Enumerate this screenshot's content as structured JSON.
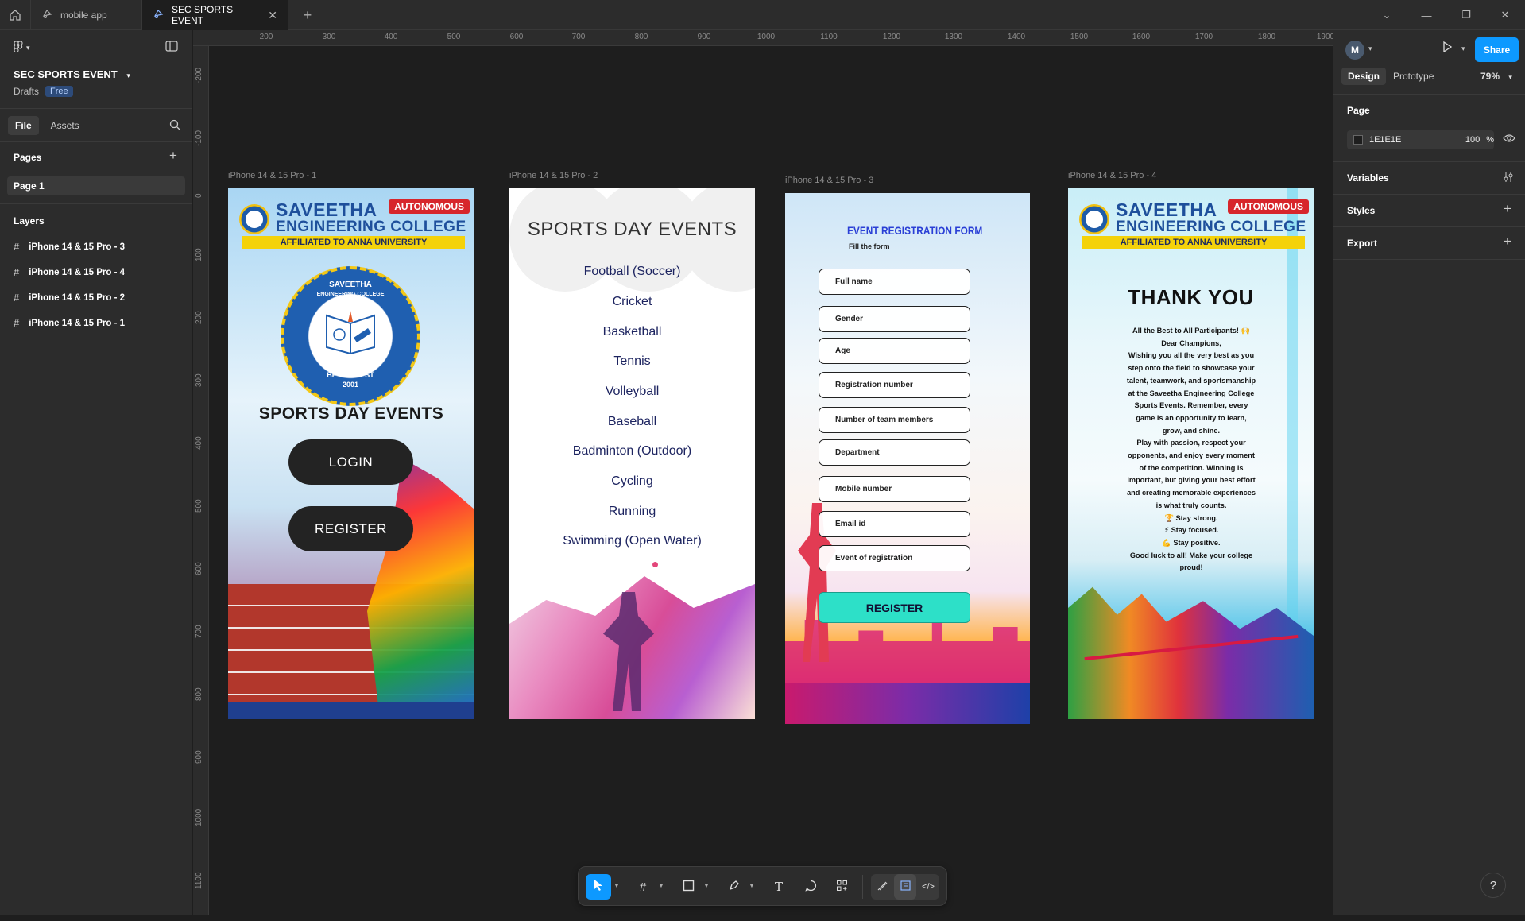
{
  "titlebar": {
    "tabs": [
      {
        "label": "mobile app"
      },
      {
        "label": "SEC SPORTS EVENT"
      }
    ]
  },
  "project": {
    "title": "SEC SPORTS EVENT",
    "location": "Drafts",
    "plan_badge": "Free"
  },
  "left_panel": {
    "tabs": [
      "File",
      "Assets"
    ],
    "pages_heading": "Pages",
    "pages": [
      "Page 1"
    ],
    "layers_heading": "Layers",
    "layers": [
      "iPhone 14 & 15 Pro - 3",
      "iPhone 14 & 15 Pro - 4",
      "iPhone 14 & 15 Pro - 2",
      "iPhone 14 & 15 Pro - 1"
    ]
  },
  "rulers": {
    "top": [
      "200",
      "300",
      "400",
      "500",
      "600",
      "700",
      "800",
      "900",
      "1000",
      "1100",
      "1200",
      "1300",
      "1400",
      "1500",
      "1600",
      "1700",
      "1800",
      "1900"
    ],
    "left": [
      "-200",
      "-100",
      "0",
      "100",
      "200",
      "300",
      "400",
      "500",
      "600",
      "700",
      "800",
      "900",
      "1000",
      "1100"
    ]
  },
  "frames": {
    "f1": {
      "label": "iPhone 14 & 15 Pro - 1",
      "college_line1": "SAVEETHA",
      "college_line2": "ENGINEERING COLLEGE",
      "autonomous": "AUTONOMOUS",
      "affiliation": "AFFILIATED TO ANNA UNIVERSITY",
      "seal_top": "SAVEETHA",
      "seal_sub": "ENGINEERING COLLEGE",
      "seal_motto": "BE THE BEST",
      "seal_year": "2001",
      "title": "SPORTS DAY EVENTS",
      "login": "LOGIN",
      "register": "REGISTER"
    },
    "f2": {
      "label": "iPhone 14 & 15 Pro - 2",
      "title": "SPORTS DAY EVENTS",
      "events": [
        "Football (Soccer)",
        "Cricket",
        "Basketball",
        "Tennis",
        "Volleyball",
        "Baseball",
        "Badminton (Outdoor)",
        "Cycling",
        "Running",
        "Swimming (Open Water)"
      ]
    },
    "f3": {
      "label": "iPhone 14 & 15 Pro - 3",
      "title": "EVENT REGISTRATION FORM",
      "subtitle": "Fill the form",
      "fields": [
        "Full name",
        "Gender",
        "Age",
        "Registration number",
        "Number of team members",
        "Department",
        "Mobile number",
        "Email id",
        "Event of registration"
      ],
      "button": "REGISTER"
    },
    "f4": {
      "label": "iPhone 14 & 15 Pro - 4",
      "college_line1": "SAVEETHA",
      "college_line2": "ENGINEERING COLLEGE",
      "autonomous": "AUTONOMOUS",
      "affiliation": "AFFILIATED TO ANNA UNIVERSITY",
      "title": "THANK YOU",
      "message_lines": [
        "All the Best to All Participants! 🙌",
        "Dear Champions,",
        "Wishing you all the very best as you",
        "step onto the field to showcase your",
        "talent, teamwork, and sportsmanship",
        "at the Saveetha Engineering College",
        "Sports Events. Remember, every",
        "game is an opportunity to learn,",
        "grow, and shine.",
        "Play with passion, respect your",
        "opponents, and enjoy every moment",
        "of the competition. Winning is",
        "important, but giving your best effort",
        "and creating memorable experiences",
        "is what truly counts.",
        "🏆 Stay strong.",
        "⚡ Stay focused.",
        "💪 Stay positive.",
        "Good luck to all! Make your college",
        "proud!"
      ]
    }
  },
  "right_panel": {
    "avatar_initial": "M",
    "share": "Share",
    "tabs": [
      "Design",
      "Prototype"
    ],
    "zoom": "79%",
    "page_heading": "Page",
    "bg_hex": "1E1E1E",
    "bg_opacity": "100",
    "bg_opacity_unit": "%",
    "variables": "Variables",
    "styles": "Styles",
    "export": "Export"
  },
  "help": "?",
  "colors": {
    "accent": "#0d99ff",
    "canvas": "#1e1e1e",
    "panel": "#2c2c2c"
  }
}
